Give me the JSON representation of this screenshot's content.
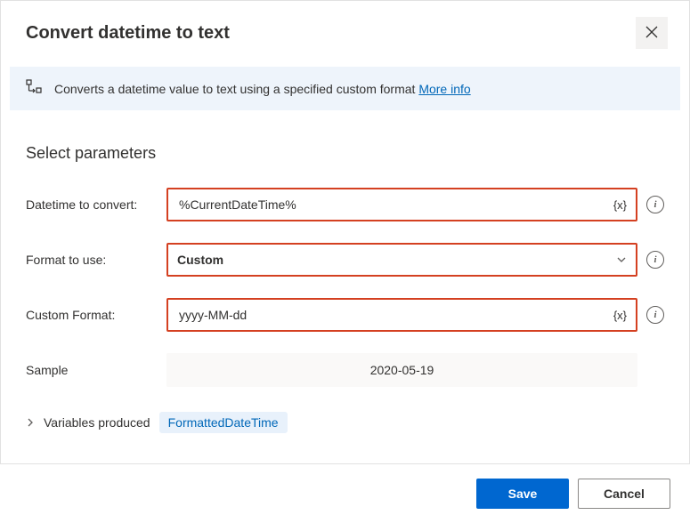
{
  "header": {
    "title": "Convert datetime to text"
  },
  "infobar": {
    "text": "Converts a datetime value to text using a specified custom format ",
    "link": "More info"
  },
  "section_title": "Select parameters",
  "fields": {
    "datetime": {
      "label": "Datetime to convert:",
      "value": "%CurrentDateTime%"
    },
    "format": {
      "label": "Format to use:",
      "value": "Custom"
    },
    "custom": {
      "label": "Custom Format:",
      "value": "yyyy-MM-dd"
    },
    "sample": {
      "label": "Sample",
      "value": "2020-05-19"
    }
  },
  "vars": {
    "label": "Variables produced",
    "chip": "FormattedDateTime"
  },
  "footer": {
    "save": "Save",
    "cancel": "Cancel"
  }
}
